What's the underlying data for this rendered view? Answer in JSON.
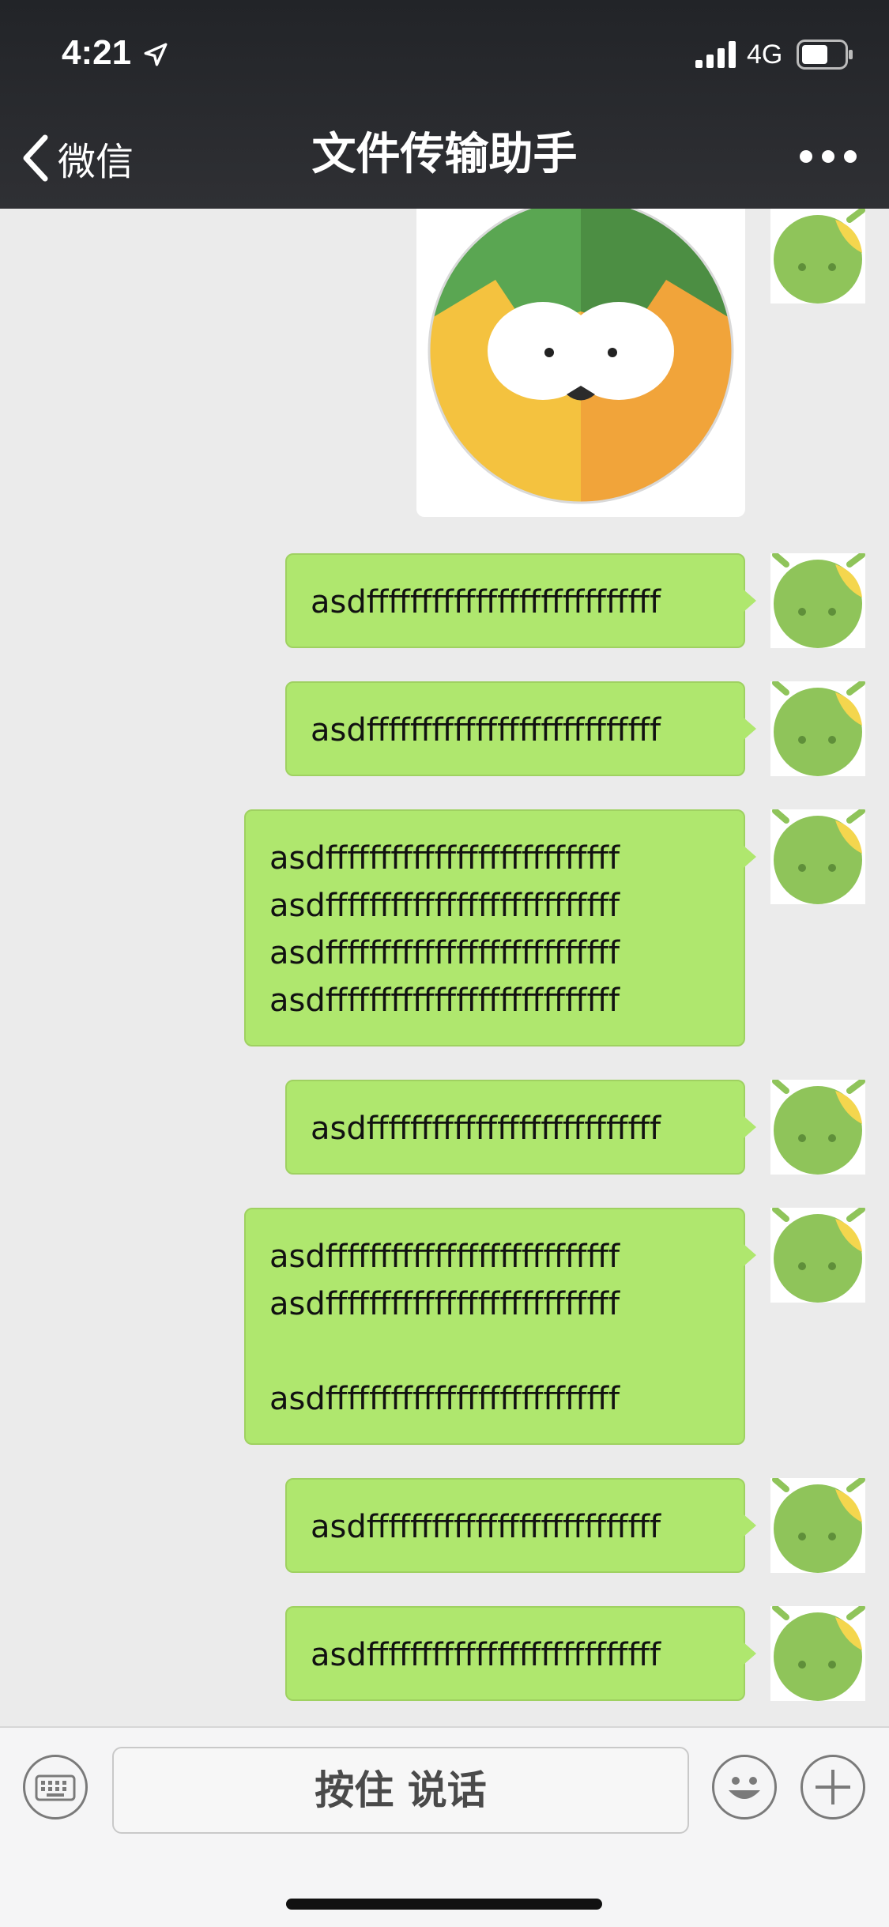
{
  "status_bar": {
    "time": "4:21",
    "network": "4G"
  },
  "nav": {
    "back_label": "微信",
    "title": "文件传输助手"
  },
  "messages": [
    {
      "type": "image",
      "image": "owl-avatar-icon"
    },
    {
      "type": "text",
      "text": "asdfffffffffffffffffffffffffff"
    },
    {
      "type": "text",
      "text": "asdfffffffffffffffffffffffffff"
    },
    {
      "type": "text",
      "text": "asdfffffffffffffffffffffffffff\nasdfffffffffffffffffffffffffff\nasdfffffffffffffffffffffffffff\nasdfffffffffffffffffffffffffff"
    },
    {
      "type": "text",
      "text": "asdfffffffffffffffffffffffffff"
    },
    {
      "type": "text",
      "text": "asdfffffffffffffffffffffffffff\nasdfffffffffffffffffffffffffff\n\nasdfffffffffffffffffffffffffff"
    },
    {
      "type": "text",
      "text": "asdfffffffffffffffffffffffffff"
    },
    {
      "type": "text",
      "text": "asdfffffffffffffffffffffffffff"
    }
  ],
  "input_bar": {
    "voice_label": "按住 说话"
  },
  "colors": {
    "bubble": "#afe76e",
    "nav_bg": "#2f3034",
    "chat_bg": "#ebebeb"
  }
}
